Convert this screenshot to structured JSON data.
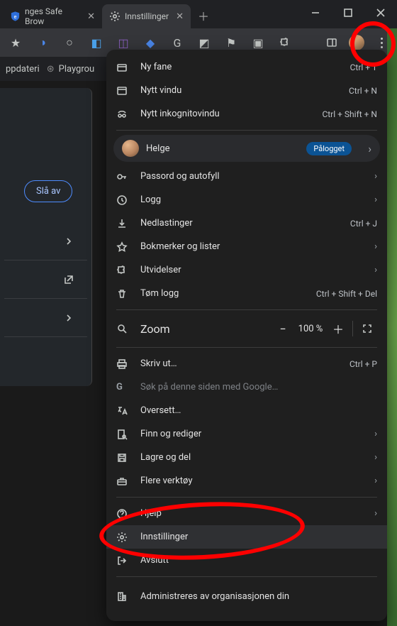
{
  "tabs": [
    {
      "label": "nges Safe Brow",
      "active": false
    },
    {
      "label": "Innstillinger",
      "active": true
    }
  ],
  "bookmarks": [
    {
      "label": "ppdateri"
    },
    {
      "label": "Playgrou"
    }
  ],
  "left_panel": {
    "button": "Slå av"
  },
  "user": {
    "name": "Helge",
    "badge": "Pålogget"
  },
  "menu": {
    "new_tab": {
      "label": "Ny fane",
      "shortcut": "Ctrl + T"
    },
    "new_window": {
      "label": "Nytt vindu",
      "shortcut": "Ctrl + N"
    },
    "incognito": {
      "label": "Nytt inkognitovindu",
      "shortcut": "Ctrl + Shift + N"
    },
    "passwords": {
      "label": "Passord og autofyll"
    },
    "history": {
      "label": "Logg"
    },
    "downloads": {
      "label": "Nedlastinger",
      "shortcut": "Ctrl + J"
    },
    "bookmarks": {
      "label": "Bokmerker og lister"
    },
    "extensions": {
      "label": "Utvidelser"
    },
    "clear_data": {
      "label": "Tøm logg",
      "shortcut": "Ctrl + Shift + Del"
    },
    "zoom": {
      "label": "Zoom",
      "value": "100 %"
    },
    "print": {
      "label": "Skriv ut…",
      "shortcut": "Ctrl + P"
    },
    "search_page": {
      "label": "Søk på denne siden med Google…"
    },
    "translate": {
      "label": "Oversett…"
    },
    "find_edit": {
      "label": "Finn og rediger"
    },
    "save_share": {
      "label": "Lagre og del"
    },
    "more_tools": {
      "label": "Flere verktøy"
    },
    "help": {
      "label": "Hjelp"
    },
    "settings": {
      "label": "Innstillinger"
    },
    "exit": {
      "label": "Avslutt"
    },
    "managed": {
      "label": "Administreres av organisasjonen din"
    }
  }
}
